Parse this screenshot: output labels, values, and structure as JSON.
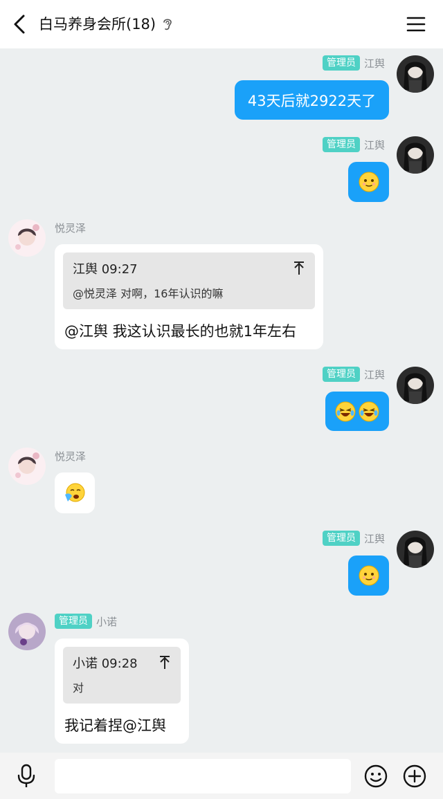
{
  "header": {
    "title": "白马养身会所(18)"
  },
  "badge_label": "管理员",
  "messages": {
    "m1": {
      "sender": "江舆",
      "text": "43天后就2922天了"
    },
    "m2": {
      "sender": "江舆",
      "emoji": "smile-emoji"
    },
    "m3": {
      "sender": "悦灵泽",
      "quote_head": "江舆 09:27",
      "quote_body": "@悦灵泽 对啊，16年认识的嘛",
      "text": "@江舆 我这认识最长的也就1年左右"
    },
    "m4": {
      "sender": "江舆",
      "emoji": "laughing-tears-emoji"
    },
    "m5": {
      "sender": "悦灵泽",
      "emoji": "crying-emoji"
    },
    "m6": {
      "sender": "江舆",
      "emoji": "smile-emoji"
    },
    "m7": {
      "sender": "小诺",
      "quote_head": "小诺 09:28",
      "quote_body": "对",
      "text": "我记着捏@江舆"
    }
  },
  "input": {
    "placeholder": ""
  },
  "colors": {
    "bubble_out": "#1aa1f9",
    "badge": "#4fd1c5",
    "background": "#eceff0"
  }
}
